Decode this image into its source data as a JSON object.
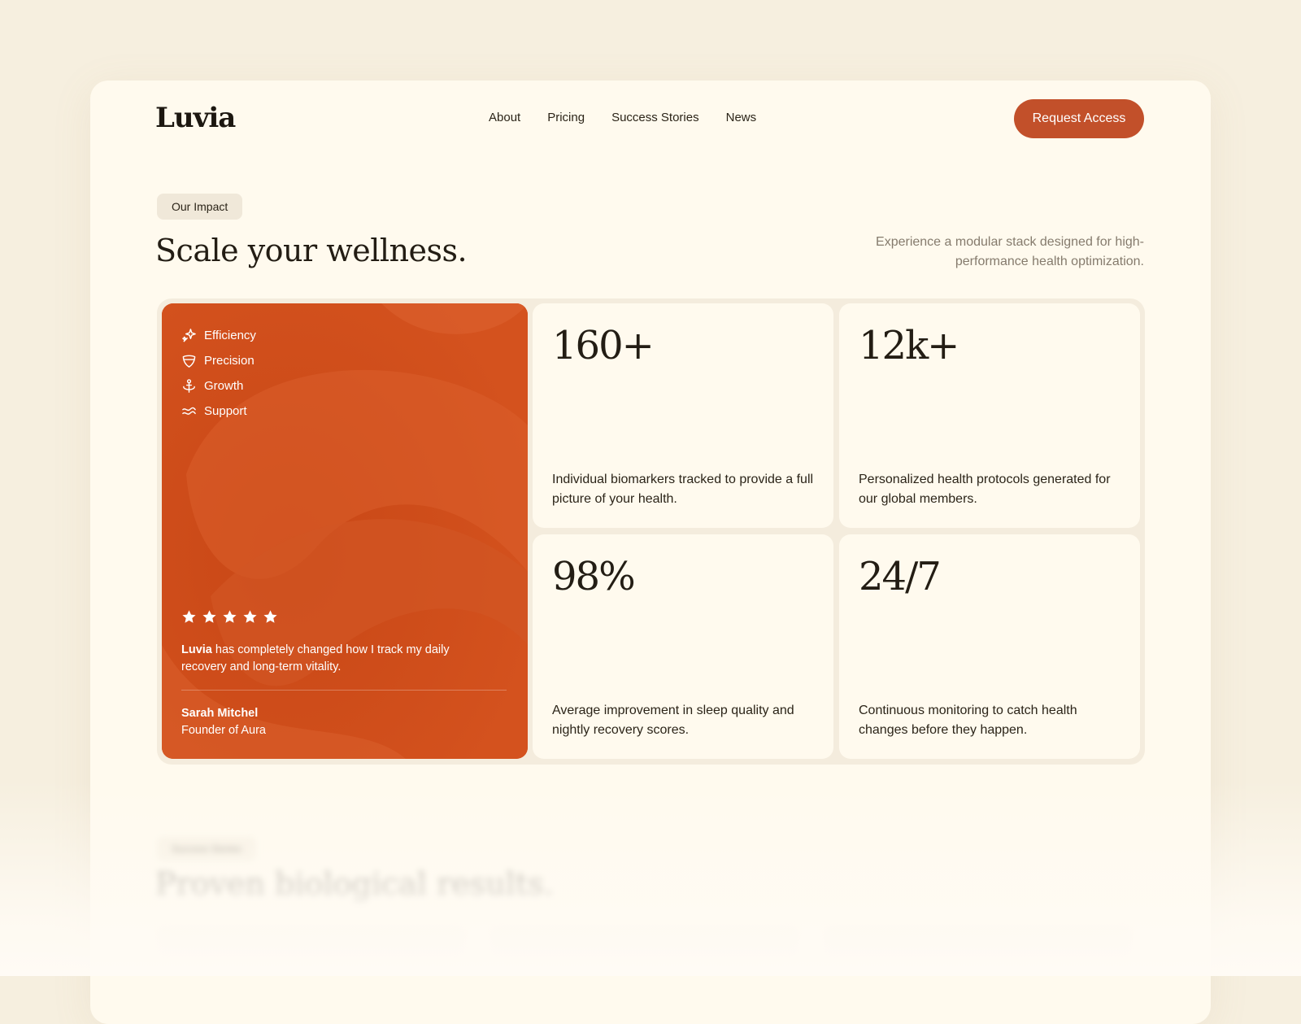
{
  "brand": {
    "logo": "Luvia"
  },
  "nav": {
    "items": [
      {
        "label": "About"
      },
      {
        "label": "Pricing"
      },
      {
        "label": "Success Stories"
      },
      {
        "label": "News"
      }
    ],
    "cta_label": "Request Access"
  },
  "colors": {
    "accent": "#c2502a",
    "card_orange": "#cf4d1c",
    "page_bg": "#f6efdf",
    "panel_bg": "#fffaee"
  },
  "impact": {
    "pill": "Our Impact",
    "headline": "Scale your wellness.",
    "subtext": "Experience a modular stack designed for high-performance health optimization."
  },
  "feature_card": {
    "features": [
      {
        "icon": "sparkle-icon",
        "label": "Efficiency"
      },
      {
        "icon": "shield-icon",
        "label": "Precision"
      },
      {
        "icon": "anchor-icon",
        "label": "Growth"
      },
      {
        "icon": "waves-icon",
        "label": "Support"
      }
    ],
    "rating": 5,
    "quote_brand": "Luvia",
    "quote_text": " has completely changed how I track my daily recovery and long-term vitality.",
    "author_name": "Sarah Mitchel",
    "author_title": "Founder of Aura"
  },
  "stats": [
    {
      "value": "160+",
      "description": "Individual biomarkers tracked to provide a full picture of your health."
    },
    {
      "value": "12k+",
      "description": "Personalized health protocols generated for our global members."
    },
    {
      "value": "98%",
      "description": "Average improvement in sleep quality and nightly recovery scores."
    },
    {
      "value": "24/7",
      "description": "Continuous monitoring to catch health changes before they happen."
    }
  ],
  "next_section": {
    "pill": "Success Stories",
    "headline": "Proven biological results."
  }
}
